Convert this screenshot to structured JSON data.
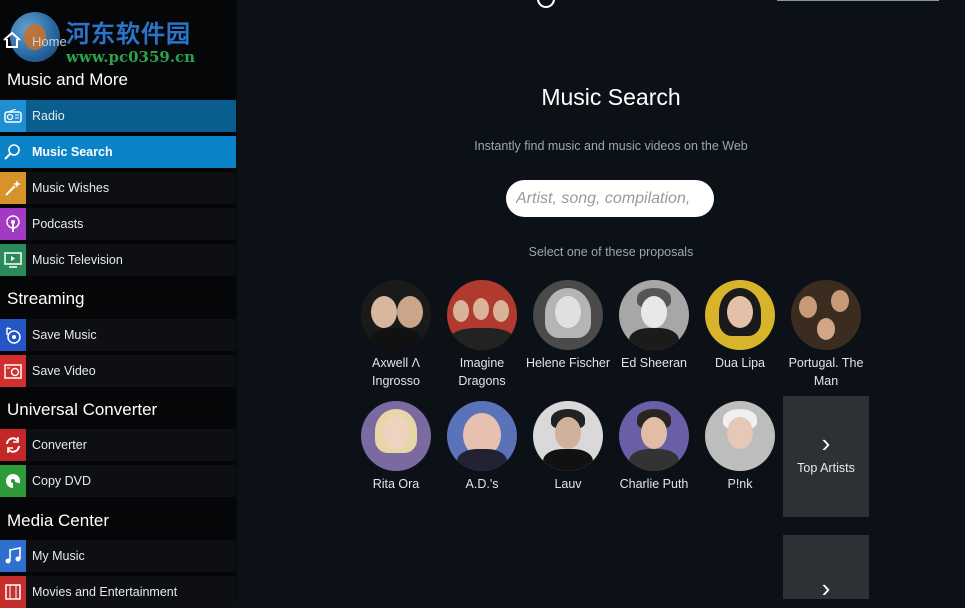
{
  "watermark": {
    "title": "河东软件园",
    "url": "www.pc0359.cn"
  },
  "home": {
    "label": "Home"
  },
  "sections": [
    {
      "title": "Music and More",
      "items": [
        {
          "label": "Radio",
          "icon": "radio-icon",
          "color": "#1e8fd3"
        },
        {
          "label": "Music Search",
          "icon": "magnifier-icon",
          "color": "#0a83c9"
        },
        {
          "label": "Music Wishes",
          "icon": "magic-wand-icon",
          "color": "#d7922a"
        },
        {
          "label": "Podcasts",
          "icon": "podcast-icon",
          "color": "#a23ac4"
        },
        {
          "label": "Music Television",
          "icon": "tv-icon",
          "color": "#2a8a5a"
        }
      ]
    },
    {
      "title": "Streaming",
      "items": [
        {
          "label": "Save Music",
          "icon": "record-music-icon",
          "color": "#2457c5"
        },
        {
          "label": "Save Video",
          "icon": "record-video-icon",
          "color": "#d22e2e"
        }
      ]
    },
    {
      "title": "Universal Converter",
      "items": [
        {
          "label": "Converter",
          "icon": "convert-icon",
          "color": "#c32727"
        },
        {
          "label": "Copy DVD",
          "icon": "dvd-icon",
          "color": "#2e9b3a"
        }
      ]
    },
    {
      "title": "Media Center",
      "items": [
        {
          "label": "My Music",
          "icon": "music-note-icon",
          "color": "#2f6fd0"
        },
        {
          "label": "Movies and Entertainment",
          "icon": "film-icon",
          "color": "#c62e2e"
        }
      ]
    }
  ],
  "main": {
    "title": "Music Search",
    "subtitle": "Instantly find music and music videos on the Web",
    "search_placeholder": "Artist, song, compilation,",
    "hint": "Select one of these proposals",
    "artists_row1": [
      {
        "name": "Axwell Λ Ingrosso",
        "tone": "#3a3a3a"
      },
      {
        "name": "Imagine Dragons",
        "tone": "#b03a2e"
      },
      {
        "name": "Helene Fischer",
        "tone": "#8c8c8c"
      },
      {
        "name": "Ed Sheeran",
        "tone": "#9a9a9a"
      },
      {
        "name": "Dua Lipa",
        "tone": "#d8b42a"
      },
      {
        "name": "Portugal. The Man",
        "tone": "#5a4636"
      }
    ],
    "artists_row2": [
      {
        "name": "Rita Ora",
        "tone": "#7a6aa0"
      },
      {
        "name": "A.D.'s",
        "tone": "#5a72b8"
      },
      {
        "name": "Lauv",
        "tone": "#bdbdbd"
      },
      {
        "name": "Charlie Puth",
        "tone": "#6a5ea8"
      },
      {
        "name": "P!nk",
        "tone": "#c9c9c9"
      }
    ],
    "top_artists_label": "Top Artists",
    "chevron": "›"
  }
}
